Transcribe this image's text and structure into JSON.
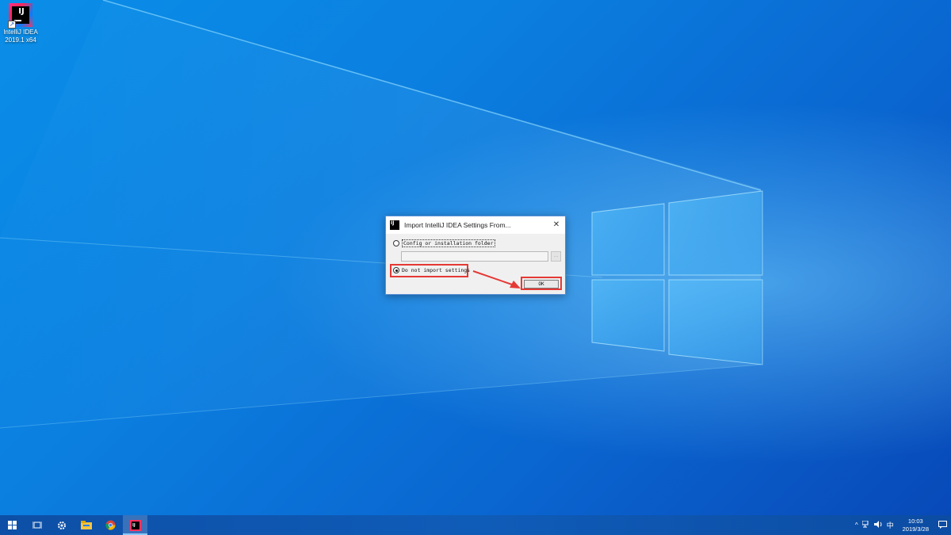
{
  "desktop": {
    "icons": [
      {
        "name": "intellij-idea-shortcut",
        "label_line1": "IntelliJ IDEA",
        "label_line2": "2019.1 x64",
        "logo_text": "IJ"
      }
    ]
  },
  "dialog": {
    "title": "Import IntelliJ IDEA Settings From...",
    "app_icon_text": "IJ",
    "close_glyph": "✕",
    "options": [
      {
        "label": "Config or installation folder",
        "checked": false
      },
      {
        "label": "Do not import settings",
        "checked": true
      }
    ],
    "path_value": "",
    "browse_glyph": "…",
    "ok_label": "OK",
    "highlight_color": "#e53935"
  },
  "taskbar": {
    "icons": [
      "windows-start-icon",
      "task-view-icon",
      "settings-gear-icon",
      "file-explorer-icon",
      "chrome-icon",
      "intellij-idea-icon"
    ],
    "tray": {
      "chevron": "^",
      "ime": "中",
      "time": "10:03",
      "date": "2019/3/28"
    }
  }
}
